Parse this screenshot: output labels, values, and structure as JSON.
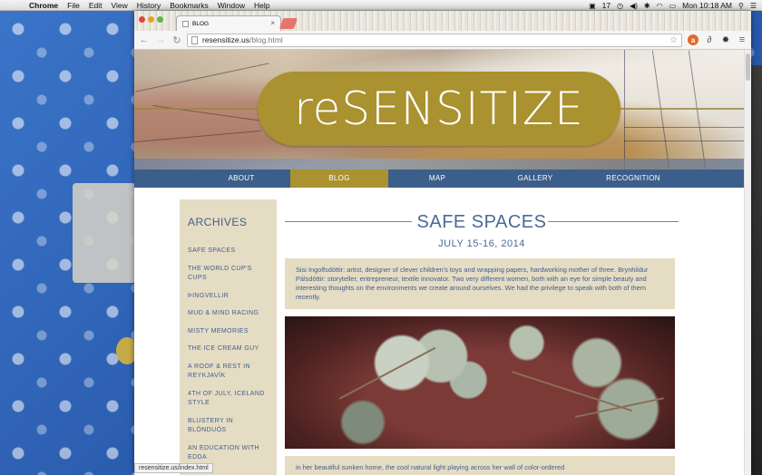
{
  "menubar": {
    "app_name": "Chrome",
    "items": [
      "File",
      "Edit",
      "View",
      "History",
      "Bookmarks",
      "Window",
      "Help"
    ],
    "battery_num": "17",
    "clock": "Mon 10:18 AM"
  },
  "browser": {
    "tab_title": "BLOG",
    "url_host": "resensitize.us",
    "url_path": "/blog.html",
    "status_url": "resensitize.us/index.html"
  },
  "site": {
    "title": "reSENSITIZE",
    "nav": [
      "ABOUT",
      "BLOG",
      "MAP",
      "GALLERY",
      "RECOGNITION"
    ],
    "active_nav": "BLOG",
    "accent_color": "#a9922f",
    "nav_color": "#3c5e8a"
  },
  "sidebar": {
    "title": "ARCHIVES",
    "items": [
      "Safe Spaces",
      "The World Cup's Cups",
      "Þingvellir",
      "Mud & Mind Racing",
      "Misty Memories",
      "The Ice Cream Guy",
      "A Roof & Rest in Reykjavík",
      "4th of July, Iceland Style",
      "Blustery in Blönduós",
      "An Education with Edda"
    ]
  },
  "post": {
    "title": "SAFE SPACES",
    "date": "JULY 15-16, 2014",
    "intro": "Sisi Ingolfsdóttir: artist, designer of clever children's toys and wrapping papers, hardworking mother of three. Brynhildur Pálsdóttir: storyteller, entrepreneur, textile innovator. Two very different women, both with an eye for simple beauty and interesting thoughts on the environments we create around ourselves. We had the privilege to speak with both of them recently.",
    "next_text": "in her beautiful sunken home, the cool natural light playing across her wall of color-ordered"
  }
}
